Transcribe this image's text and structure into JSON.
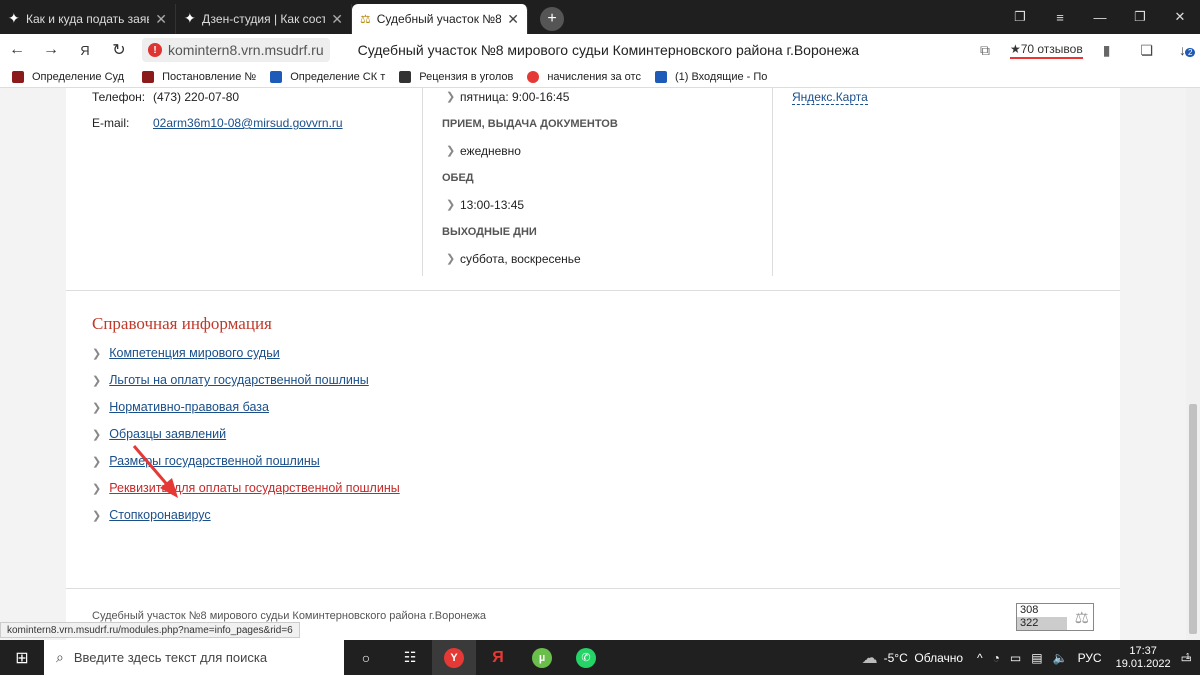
{
  "browser": {
    "tabs": [
      {
        "label": "Как и куда подать заявлен"
      },
      {
        "label": "Дзен-студия | Как состави"
      },
      {
        "label": "Судебный участок №8"
      }
    ],
    "url": "komintern8.vrn.msudrf.ru",
    "page_title": "Судебный участок №8 мирового судьи Коминтерновского района г.Воронежа",
    "reviews": "★70 отзывов",
    "downloads_badge": "2",
    "bookmarks": [
      {
        "label": "Определение Суд",
        "color": "#8b1a1a"
      },
      {
        "label": "Постановление №",
        "color": "#8b1a1a"
      },
      {
        "label": "Определение СК т",
        "color": "#1e5bb8"
      },
      {
        "label": "Рецензия в уголов",
        "color": "#333333"
      },
      {
        "label": "начисления за отс",
        "color": "#e53935"
      },
      {
        "label": "(1) Входящие - По",
        "color": "#1e5bb8"
      }
    ]
  },
  "contacts": {
    "phone_label": "Телефон:",
    "phone_value": "(473) 220-07-80",
    "email_label": "E-mail:",
    "email_value": "02arm36m10-08@mirsud.govvrn.ru"
  },
  "schedule": {
    "friday": "пятница: 9:00-16:45",
    "docs_heading": "ПРИЕМ, ВЫДАЧА ДОКУМЕНТОВ",
    "docs_value": "ежедневно",
    "lunch_heading": "ОБЕД",
    "lunch_value": "13:00-13:45",
    "weekend_heading": "ВЫХОДНЫЕ ДНИ",
    "weekend_value": "суббота, воскресенье"
  },
  "map_link": "Яндекс.Карта",
  "reference": {
    "heading": "Справочная информация",
    "links": [
      "Компетенция мирового судьи",
      "Льготы на оплату государственной пошлины",
      "Нормативно-правовая база",
      "Образцы заявлений",
      "Размеры государственной пошлины",
      "Реквизиты для оплаты государственной пошлины",
      "Стопкоронавирус"
    ]
  },
  "footer": {
    "text": "Судебный участок №8 мирового судьи Коминтерновского района г.Воронежа",
    "counter_top": "308",
    "counter_bottom": "322"
  },
  "status_url": "komintern8.vrn.msudrf.ru/modules.php?name=info_pages&rid=6",
  "taskbar": {
    "search_placeholder": "Введите здесь текст для поиска",
    "weather": "-5°C  Облачно",
    "lang": "РУС",
    "time": "17:37",
    "date": "19.01.2022",
    "notif_count": "1"
  },
  "colors": {
    "accent_red": "#c0392b",
    "link_blue": "#1a4f8a",
    "arrow": "#e53935"
  }
}
